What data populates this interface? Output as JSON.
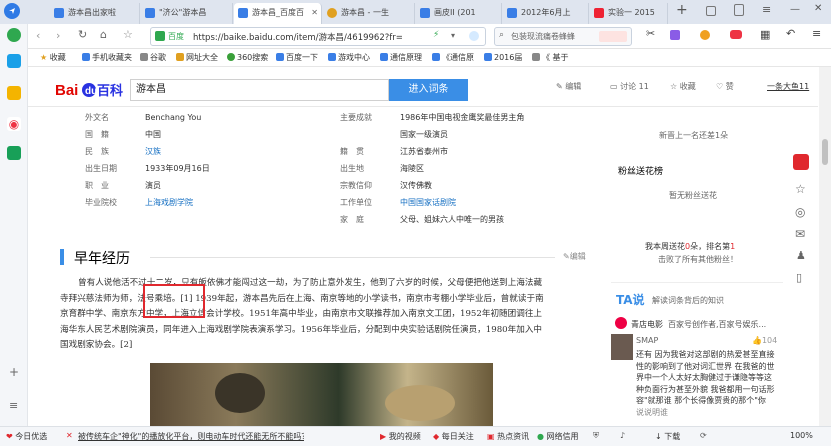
{
  "browser": {
    "tabs": [
      {
        "title": "游本昌出家啦",
        "icon_color": "#3a7ee6"
      },
      {
        "title": "\"济公\"游本昌",
        "icon_color": "#3a7ee6"
      },
      {
        "title": "游本昌_百度百",
        "icon_color": "#3a7ee6",
        "active": true
      },
      {
        "title": "游本昌 - 一生",
        "icon_color": "#e0a020"
      },
      {
        "title": "画皮II (201",
        "icon_color": "#3a7ee6"
      },
      {
        "title": "2012年6月上",
        "icon_color": "#3a7ee6"
      },
      {
        "title": "实验一 2015",
        "icon_color": "#e23"
      }
    ],
    "url_site": "百度",
    "url": "https://baike.baidu.com/item/游本昌/4619962?fr=ala",
    "search_placeholder": "包装现流痛卷蜂蜂",
    "favorites": [
      {
        "label": "收藏",
        "color": "#e0a020"
      },
      {
        "label": "手机收藏夹",
        "color": "#3a7ee6"
      },
      {
        "label": "谷歌",
        "color": "#888"
      },
      {
        "label": "网址大全",
        "color": "#e0a020"
      },
      {
        "label": "360搜索",
        "color": "#3aa03a"
      },
      {
        "label": "百度一下",
        "color": "#3a7ee6"
      },
      {
        "label": "游戏中心",
        "color": "#3a7ee6"
      },
      {
        "label": "通信原理",
        "color": "#3a7ee6"
      },
      {
        "label": "《通信原",
        "color": "#3a7ee6"
      },
      {
        "label": "2016届",
        "color": "#3a7ee6"
      },
      {
        "label": "《 基于",
        "color": "#888"
      }
    ]
  },
  "baike": {
    "logo_text": "百科",
    "search_value": "游本昌",
    "search_button": "进入词条",
    "actions": {
      "edit": "编辑",
      "discuss": "讨论 11",
      "collect": "收藏",
      "like": "赞"
    },
    "user": "一条大鱼11"
  },
  "info_left": [
    {
      "label": "外文名",
      "value": "Benchang You"
    },
    {
      "label": "国　籍",
      "value": "中国"
    },
    {
      "label": "民　族",
      "value": "汉族",
      "link": true
    },
    {
      "label": "出生日期",
      "value": "1933年09月16日"
    },
    {
      "label": "职　业",
      "value": "演员"
    },
    {
      "label": "毕业院校",
      "value": "上海戏剧学院",
      "link": true
    }
  ],
  "info_right": [
    {
      "label": "主要成就",
      "value": "1986年中国电视金鹰奖最佳男主角"
    },
    {
      "label": "",
      "value": "国家一级演员"
    },
    {
      "label": "籍　贯",
      "value": "江苏省泰州市"
    },
    {
      "label": "出生地",
      "value": "海陵区"
    },
    {
      "label": "宗教信仰",
      "value": "汉传佛教"
    },
    {
      "label": "工作单位",
      "value": "中国国家话剧院"
    },
    {
      "label": "家　庭",
      "value": "父母、姐妹六人中唯一的男孩"
    }
  ],
  "section": {
    "title": "早年经历",
    "edit": "编辑",
    "lines": [
      "曾有人说他活不过十二岁，只有皈依佛才能闯过这一劫，为了防止意外发生，他到了六岁的时候，父母便把他送到上海法藏",
      "寺拜兴慈法师为师，法号乘培。[1] 1939年起，游本昌先后在上海、南京等地的小学读书，南京市考棚小学毕业后，曾就读于南",
      "京育群中学、南京东方中学，上海立信会计学校。1951年高中毕业，由南京市文联推荐加入南京文工团，1952年初随团调往上",
      "海华东人民艺术剧院演员，同年进入上海戏剧学院表演系学习。1956年毕业后，分配到中央实验话剧院任演员，1980年加入中",
      "国戏剧家协会。[2]"
    ]
  },
  "right_panel": {
    "flowers_today": "新晋上一名还差1朵",
    "fans_title": "粉丝送花榜",
    "no_fans": "暂无粉丝送花",
    "week_prefix": "我本周送花",
    "week_count": "0",
    "week_mid": "朵，排名第",
    "week_rank": "1",
    "week_sub": "击败了所有其他粉丝！",
    "ta_title": "解读词条背后的知识",
    "ta_author": "青店电影",
    "ta_desc": "百家号创作者,百家号娱乐...",
    "comment_user": "SMAP",
    "comment_likes": "104",
    "comment_text": [
      "还有 因为我爸对这部剧的热爱甚至直接",
      "性的影响到了他对词汇世界 在我爸的世",
      "界中一个人太好太胸健过于谦隐等等这",
      "种负面行为甚至外貌 我爸都用一句话形",
      "容\"就那谁 那个长得像贾贵的那个\"你",
      "说说明谁"
    ]
  },
  "statusbar": {
    "left": "今日优选",
    "news": "被传统车企\"神化\"的播放化平台，则电动车时代还能无所不能吗？",
    "video": "我的视频",
    "daily": "每日关注",
    "hot": "热点资讯",
    "net": "网络信用",
    "download": "下载",
    "zoom": "100%"
  }
}
